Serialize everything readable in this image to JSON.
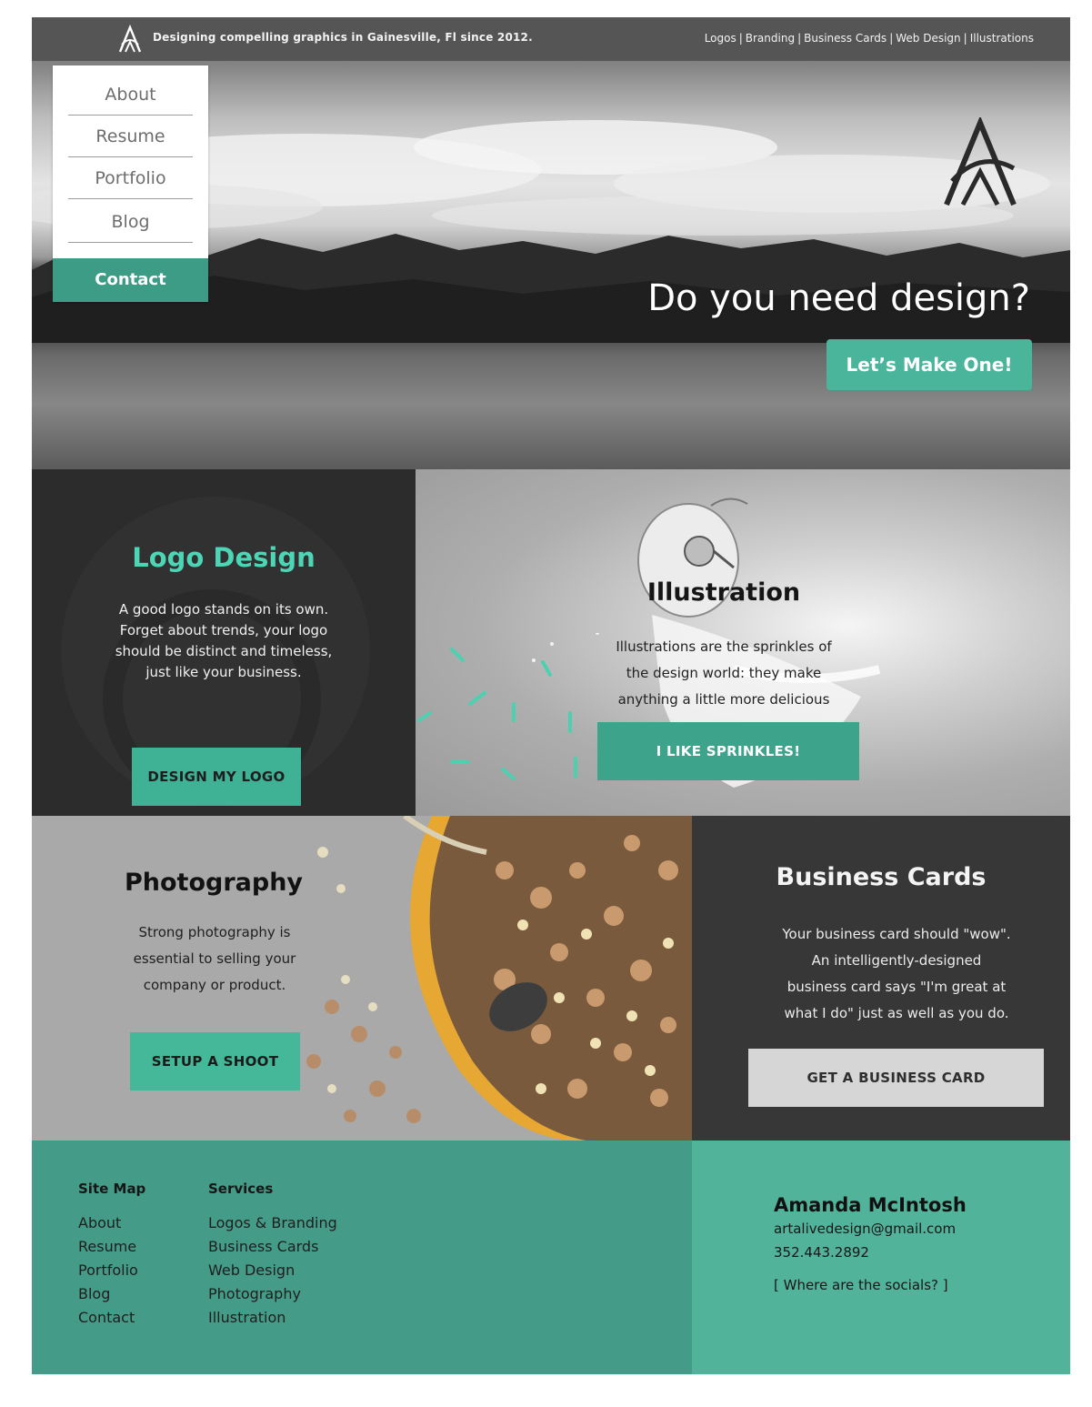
{
  "topbar": {
    "tagline": "Designing compelling graphics in Gainesville, Fl since 2012.",
    "quicklinks": [
      "Logos",
      "Branding",
      "Business Cards",
      "Web Design",
      "Illustrations"
    ],
    "logo_icon": "monogram-logo-icon"
  },
  "nav": {
    "items": [
      "About",
      "Resume",
      "Portfolio",
      "Blog"
    ],
    "contact": "Contact"
  },
  "hero": {
    "headline": "Do you need design?",
    "cta": "Let’s Make One!"
  },
  "logo_design": {
    "title": "Logo Design",
    "body": "A good logo stands on its own.\nForget about trends, your logo\nshould be distinct and timeless,\njust like your business.",
    "button": "DESIGN MY LOGO"
  },
  "illustration": {
    "title": "Illustration",
    "body": "Illustrations are the sprinkles of\nthe design world: they make\nanything a little more delicious",
    "button": "I LIKE SPRINKLES!"
  },
  "photography": {
    "title": "Photography",
    "body": "Strong photography is\nessential to selling your\ncompany or product.",
    "button": "SETUP A SHOOT"
  },
  "business_cards": {
    "title": "Business Cards",
    "body": "Your business card should \"wow\".\nAn intelligently-designed\nbusiness card says \"I'm great at\nwhat I do\" just as well as you do.",
    "button": "GET A BUSINESS CARD"
  },
  "footer": {
    "sitemap": {
      "heading": "Site Map",
      "links": [
        "About",
        "Resume",
        "Portfolio",
        "Blog",
        "Contact"
      ]
    },
    "services": {
      "heading": "Services",
      "links": [
        "Logos & Branding",
        "Business Cards",
        "Web Design",
        "Photography",
        "Illustration"
      ]
    },
    "contact": {
      "name": "Amanda McIntosh",
      "email": "artalivedesign@gmail.com",
      "phone": "352.443.2892",
      "socials": "[ Where are the socials? ]"
    }
  },
  "colors": {
    "accent": "#4ab59a",
    "accent_dark": "#3c9c85",
    "dark": "#2c2c2c",
    "topbar": "#555555"
  }
}
